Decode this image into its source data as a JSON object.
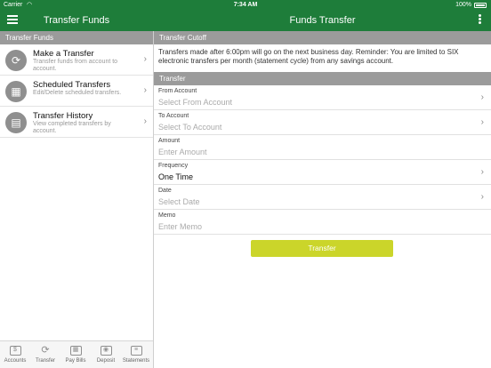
{
  "status_bar": {
    "carrier": "Carrier",
    "wifi": "wifi-icon",
    "time": "7:34 AM",
    "battery": "100%"
  },
  "nav": {
    "left_title": "Transfer Funds",
    "right_title": "Funds Transfer"
  },
  "left_panel": {
    "header": "Transfer Funds",
    "items": [
      {
        "title": "Make a Transfer",
        "subtitle": "Transfer funds from account to account.",
        "icon": "transfer-icon"
      },
      {
        "title": "Scheduled Transfers",
        "subtitle": "Edit/Delete scheduled transfers.",
        "icon": "calendar-icon"
      },
      {
        "title": "Transfer History",
        "subtitle": "View completed transfers by account.",
        "icon": "history-icon"
      }
    ]
  },
  "tabs": [
    {
      "label": "Accounts",
      "icon": "accounts-icon"
    },
    {
      "label": "Transfer",
      "icon": "transfer-icon"
    },
    {
      "label": "Pay Bills",
      "icon": "calculator-icon"
    },
    {
      "label": "Deposit",
      "icon": "camera-icon"
    },
    {
      "label": "Statements",
      "icon": "statement-icon"
    }
  ],
  "right_panel": {
    "cutoff_header": "Transfer Cutoff",
    "cutoff_text": "Transfers made after 6:00pm will go on the next business day.  Reminder: You are limited to SIX electronic transfers per month (statement cycle) from any savings account.",
    "form_header": "Transfer",
    "fields": {
      "from_account": {
        "label": "From Account",
        "placeholder": "Select From Account"
      },
      "to_account": {
        "label": "To Account",
        "placeholder": "Select To Account"
      },
      "amount": {
        "label": "Amount",
        "placeholder": "Enter Amount"
      },
      "frequency": {
        "label": "Frequency",
        "value": "One Time"
      },
      "date": {
        "label": "Date",
        "placeholder": "Select Date"
      },
      "memo": {
        "label": "Memo",
        "placeholder": "Enter Memo"
      }
    },
    "submit_label": "Transfer"
  },
  "colors": {
    "brand": "#1e7d3a",
    "header_gray": "#9b9b9b",
    "button": "#cbd52a"
  }
}
